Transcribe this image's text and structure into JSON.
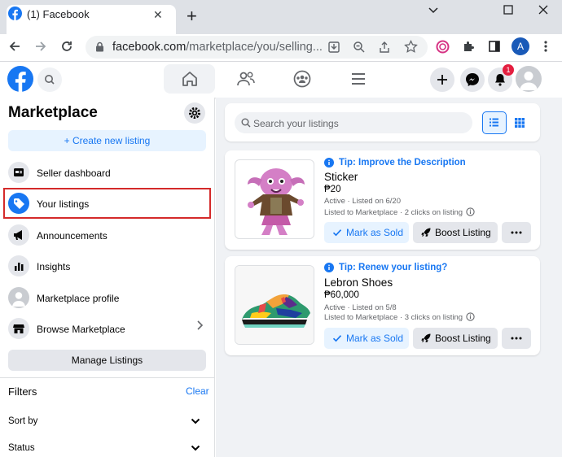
{
  "browser": {
    "tab_title": "(1) Facebook",
    "url_host": "facebook.com",
    "url_path": "/marketplace/you/selling...",
    "profile_initial": "A"
  },
  "header": {
    "notification_count": "1",
    "nav_icons": [
      "home-icon",
      "friends-icon",
      "groups-icon",
      "menu-icon"
    ]
  },
  "sidebar": {
    "title": "Marketplace",
    "create_label": "+ Create new listing",
    "items": [
      {
        "label": "Seller dashboard",
        "icon": "dashboard-icon"
      },
      {
        "label": "Your listings",
        "icon": "tag-icon"
      },
      {
        "label": "Announcements",
        "icon": "megaphone-icon"
      },
      {
        "label": "Insights",
        "icon": "insights-icon"
      },
      {
        "label": "Marketplace profile",
        "icon": "profile-icon"
      },
      {
        "label": "Browse Marketplace",
        "icon": "store-icon"
      }
    ],
    "manage_label": "Manage Listings",
    "filters_label": "Filters",
    "clear_label": "Clear",
    "sort_label": "Sort by",
    "status_label": "Status"
  },
  "main": {
    "search_placeholder": "Search your listings",
    "listings": [
      {
        "tip": "Tip: Improve the Description",
        "title": "Sticker",
        "price": "₱20",
        "status_line": "Active · Listed on 6/20",
        "clicks_line": "Listed to Marketplace · 2 clicks on listing",
        "sold_label": "Mark as Sold",
        "boost_label": "Boost Listing"
      },
      {
        "tip": "Tip: Renew your listing?",
        "title": "Lebron Shoes",
        "price": "₱60,000",
        "status_line": "Active · Listed on 5/8",
        "clicks_line": "Listed to Marketplace · 3 clicks on listing",
        "sold_label": "Mark as Sold",
        "boost_label": "Boost Listing"
      }
    ]
  },
  "colors": {
    "fb_blue": "#1877f2",
    "highlight_red": "#d42a2a",
    "badge_red": "#e41e3f"
  }
}
